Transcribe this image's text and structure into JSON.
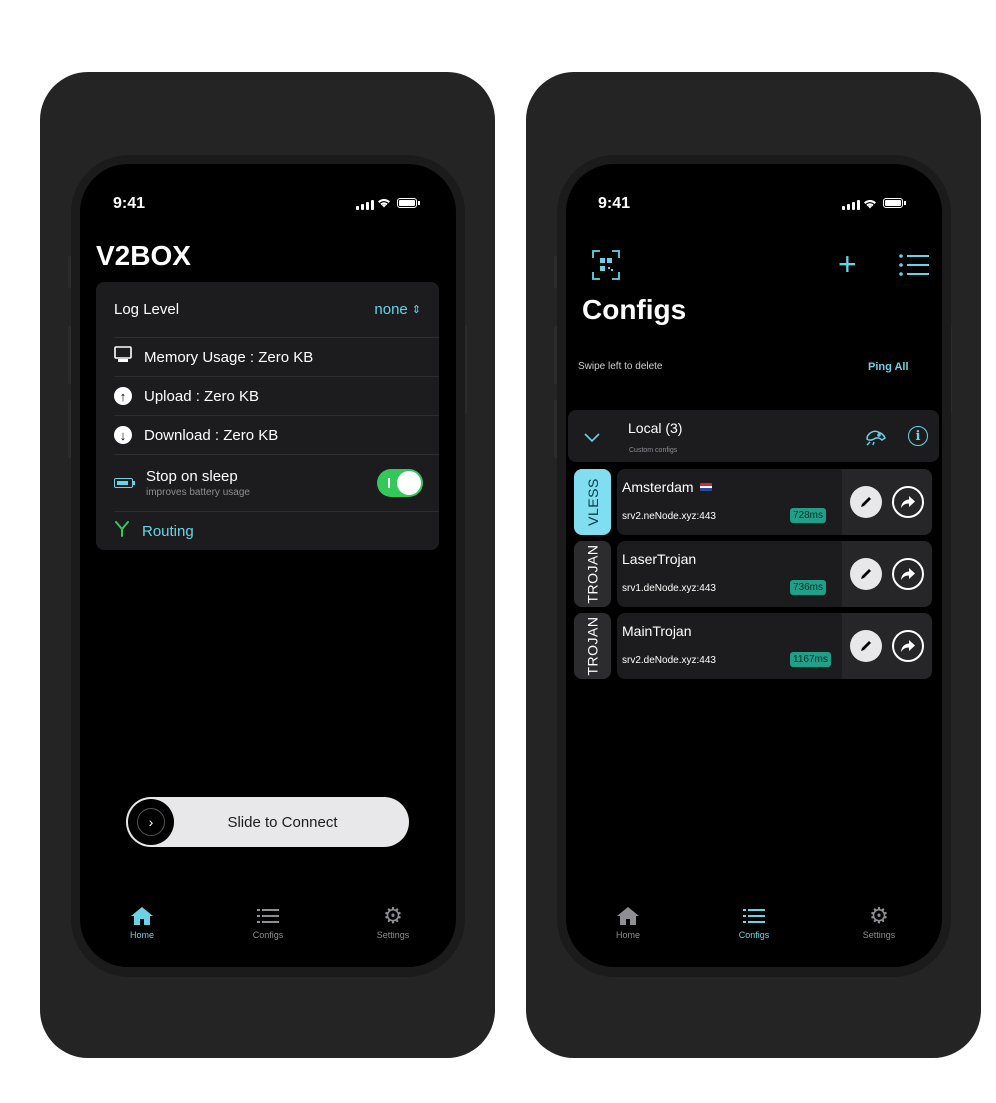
{
  "left": {
    "status_time": "9:41",
    "app_title": "V2BOX",
    "log_level_label": "Log Level",
    "log_level_value": "none",
    "memory_label": "Memory Usage : Zero KB",
    "upload_label": "Upload : Zero KB",
    "download_label": "Download : Zero KB",
    "sleep_label": "Stop on sleep",
    "sleep_sub": "improves battery usage",
    "sleep_toggle_on": true,
    "routing_label": "Routing",
    "slide_label": "Slide to Connect",
    "nav": [
      {
        "label": "Home",
        "icon": "home-icon",
        "active": true
      },
      {
        "label": "Configs",
        "icon": "list-icon",
        "active": false
      },
      {
        "label": "Settings",
        "icon": "gear-icon",
        "active": false
      }
    ]
  },
  "right": {
    "status_time": "9:41",
    "title": "Configs",
    "swipe_hint": "Swipe left to delete",
    "ping_all": "Ping All",
    "group_title": "Local (3)",
    "group_sub": "Custom configs",
    "configs": [
      {
        "protocol": "VLESS",
        "name": "Amsterdam",
        "flag": "netherlands-flag",
        "server": "srv2.neNode.xyz:443",
        "ping": "728ms",
        "selected": true
      },
      {
        "protocol": "TROJAN",
        "name": "LaserTrojan",
        "server": "srv1.deNode.xyz:443",
        "ping": "736ms",
        "selected": false
      },
      {
        "protocol": "TROJAN",
        "name": "MainTrojan",
        "server": "srv2.deNode.xyz:443",
        "ping": "1167ms",
        "selected": false
      }
    ],
    "nav": [
      {
        "label": "Home",
        "icon": "home-icon",
        "active": false
      },
      {
        "label": "Configs",
        "icon": "list-icon",
        "active": true
      },
      {
        "label": "Settings",
        "icon": "gear-icon",
        "active": false
      }
    ]
  },
  "colors": {
    "accent": "#66d4e6",
    "toggle_green": "#34c759",
    "ping_green": "#1ea089",
    "vless_tag": "#7fdff0"
  }
}
